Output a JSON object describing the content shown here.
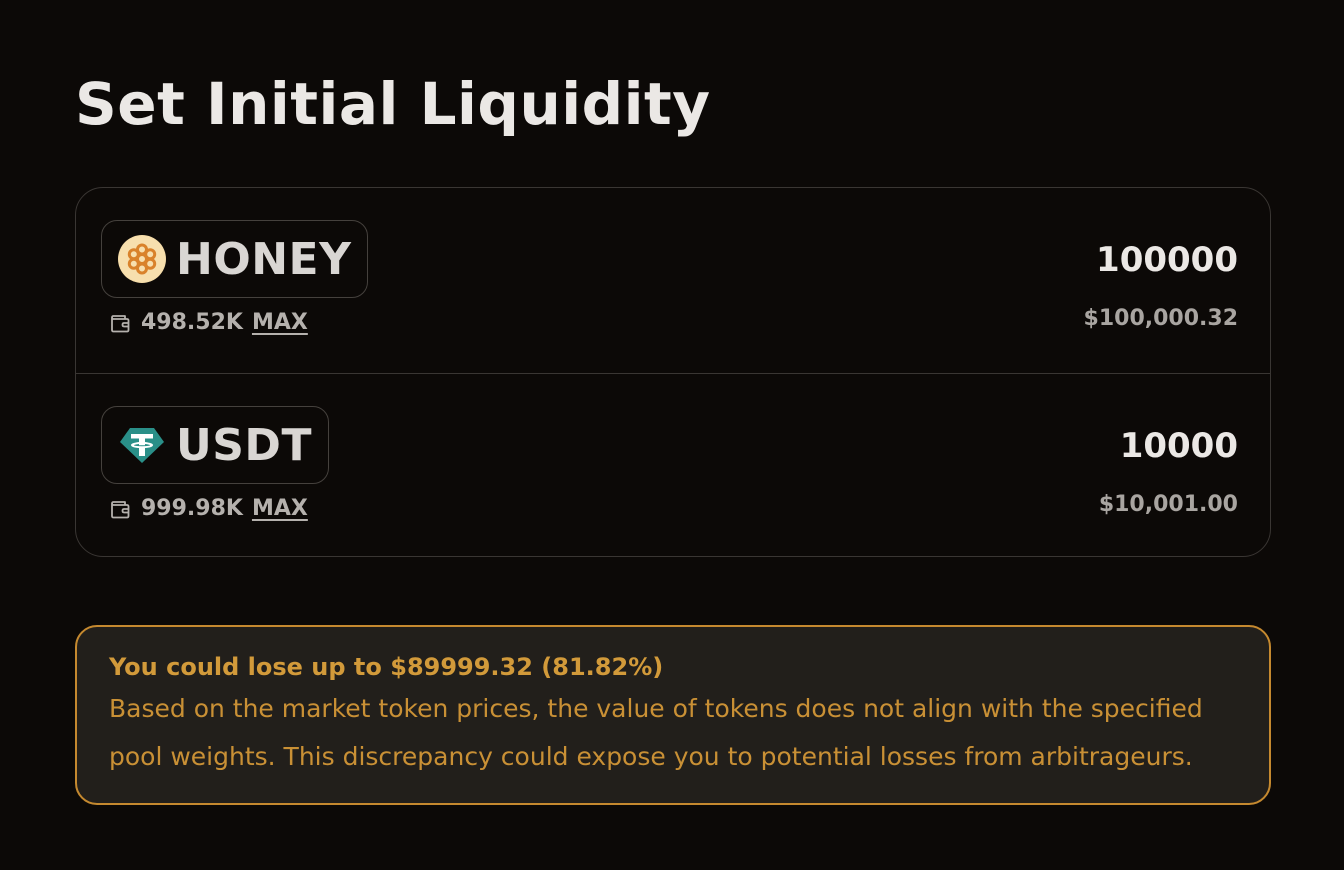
{
  "page": {
    "title": "Set Initial Liquidity"
  },
  "tokens": [
    {
      "symbol": "HONEY",
      "icon": "honey-icon",
      "balance": "498.52K",
      "max_label": "MAX",
      "amount": "100000",
      "usd_value": "$100,000.32"
    },
    {
      "symbol": "USDT",
      "icon": "tether-icon",
      "balance": "999.98K",
      "max_label": "MAX",
      "amount": "10000",
      "usd_value": "$10,001.00"
    }
  ],
  "warning": {
    "title": "You could lose up to $89999.32 (81.82%)",
    "body": "Based on the market token prices, the value of tokens does not align with the specified pool weights. This discrepancy could expose you to potential losses from arbitrageurs."
  },
  "colors": {
    "background": "#0c0907",
    "border": "#3a3633",
    "warning_accent": "#c5892f",
    "warning_bg": "#221f1b",
    "honey": "#e8922a",
    "tether": "#26a17b"
  }
}
